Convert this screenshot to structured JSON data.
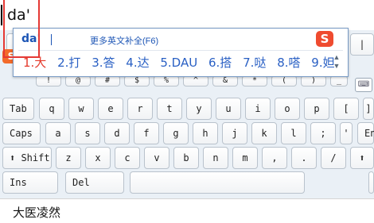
{
  "editor": {
    "typed_text": "da'"
  },
  "ime": {
    "pinyin": "da'",
    "more_english": "更多英文补全(F6)",
    "logo": "S",
    "candidates": [
      "1.大",
      "2.打",
      "3.答",
      "4.达",
      "5.DAU",
      "6.搭",
      "7.哒",
      "8.嗒",
      "9.妲"
    ],
    "nav_up": "▲",
    "nav_down": "▼"
  },
  "left_logo": "S",
  "keyboard": {
    "row1": [
      "~",
      "!",
      "@",
      "#",
      "$",
      "%",
      "^",
      "&",
      "*",
      "(",
      ")",
      "_",
      "+",
      "|"
    ],
    "row2": [
      "Tab",
      "q",
      "w",
      "e",
      "r",
      "t",
      "y",
      "u",
      "i",
      "o",
      "p",
      "[",
      "]",
      "\\"
    ],
    "row3": [
      "Caps",
      "a",
      "s",
      "d",
      "f",
      "g",
      "h",
      "j",
      "k",
      "l",
      ";",
      "'",
      "Ent"
    ],
    "row4": [
      "⬆ Shift",
      "z",
      "x",
      "c",
      "v",
      "b",
      "n",
      "m",
      ",",
      ".",
      "/",
      "⬆"
    ],
    "row5": [
      "Ins",
      "Del"
    ]
  },
  "bottom": {
    "text": "大医凌然"
  }
}
